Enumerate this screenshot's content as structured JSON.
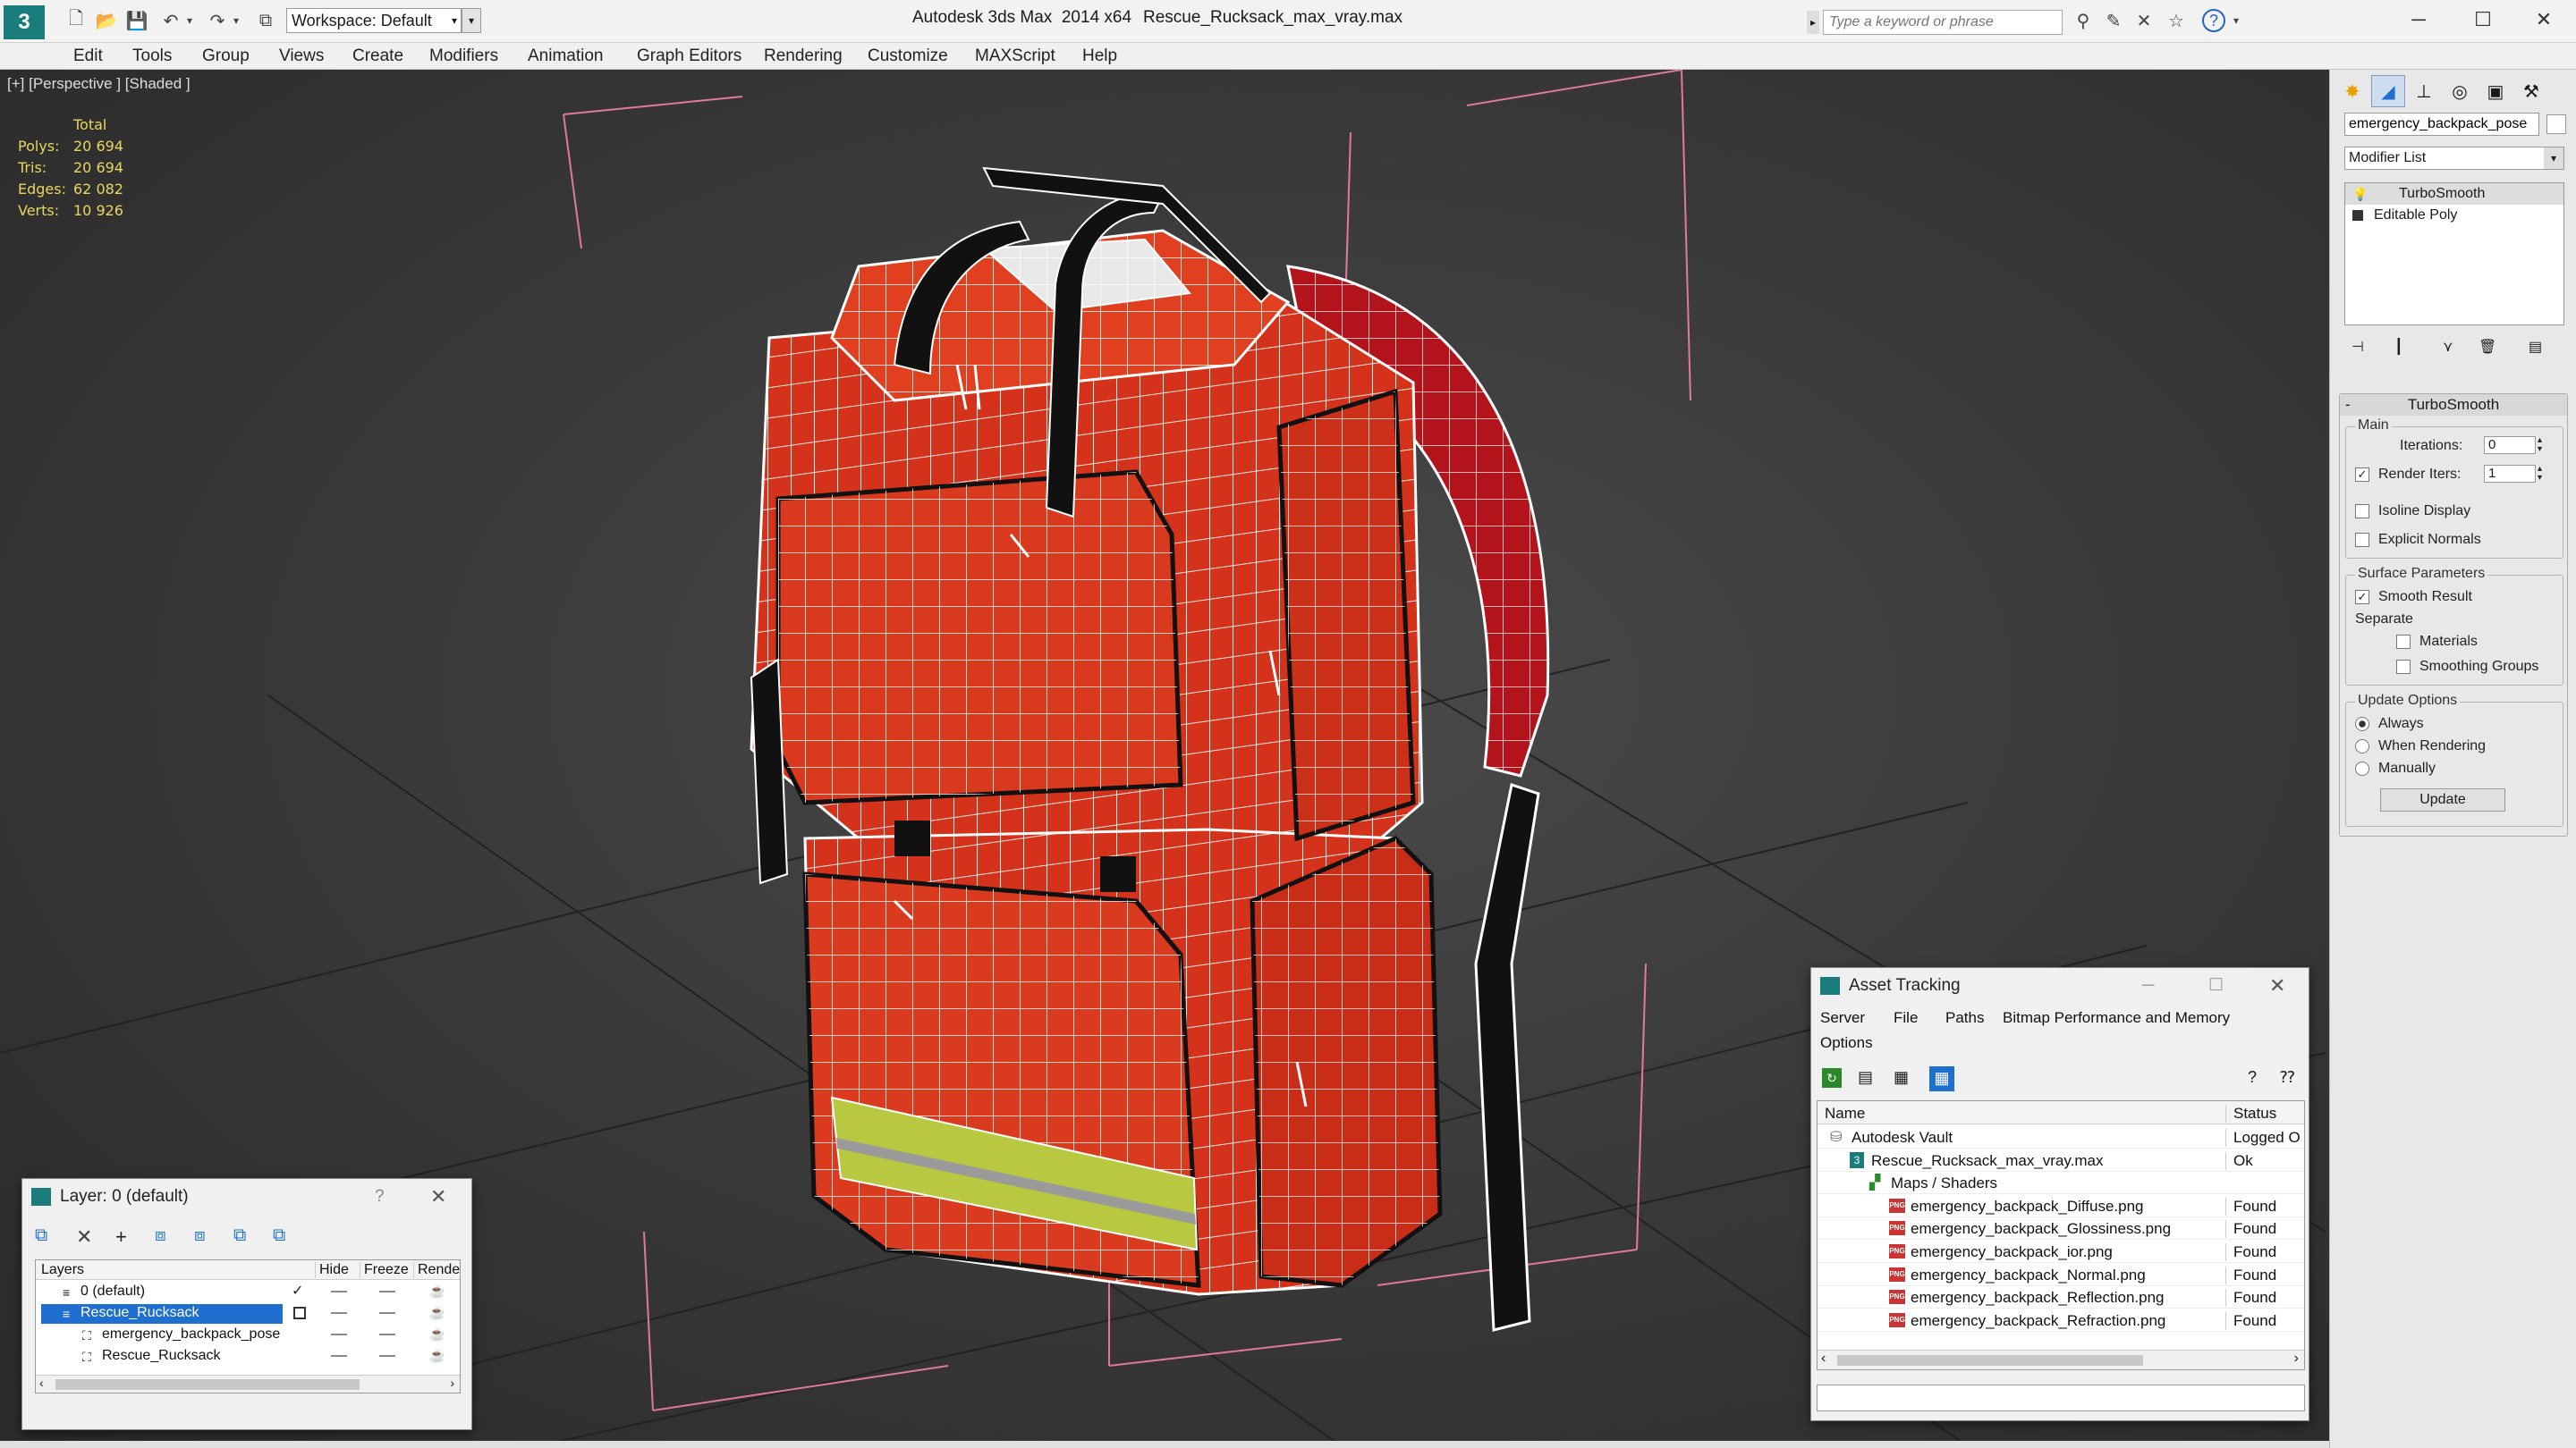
{
  "titlebar": {
    "app_title": "Autodesk 3ds Max  2014 x64",
    "file_title": "Rescue_Rucksack_max_vray.max",
    "workspace_label": "Workspace: Default",
    "search_placeholder": "Type a keyword or phrase"
  },
  "menu": [
    "Edit",
    "Tools",
    "Group",
    "Views",
    "Create",
    "Modifiers",
    "Animation",
    "Graph Editors",
    "Rendering",
    "Customize",
    "MAXScript",
    "Help"
  ],
  "viewport": {
    "label": "[+] [Perspective ] [Shaded ]",
    "stats": {
      "header": "Total",
      "rows": [
        {
          "label": "Polys:",
          "value": "20 694"
        },
        {
          "label": "Tris:",
          "value": "20 694"
        },
        {
          "label": "Edges:",
          "value": "62 082"
        },
        {
          "label": "Verts:",
          "value": "10 926"
        }
      ]
    }
  },
  "command_panel": {
    "object_name": "emergency_backpack_pose",
    "modifier_list": "Modifier List",
    "stack": [
      "TurboSmooth",
      "Editable Poly"
    ],
    "rollout_title": "TurboSmooth",
    "main_group": "Main",
    "iterations_label": "Iterations:",
    "iterations_value": "0",
    "render_iters_label": "Render Iters:",
    "render_iters_value": "1",
    "isoline_label": "Isoline Display",
    "explicit_normals_label": "Explicit Normals",
    "surface_group": "Surface Parameters",
    "smooth_result_label": "Smooth Result",
    "separate_label": "Separate",
    "materials_label": "Materials",
    "smoothing_groups_label": "Smoothing Groups",
    "update_group": "Update Options",
    "always_label": "Always",
    "when_rendering_label": "When Rendering",
    "manually_label": "Manually",
    "update_button": "Update"
  },
  "layer_dialog": {
    "title": "Layer: 0 (default)",
    "help": "?",
    "columns": [
      "Layers",
      "Hide",
      "Freeze",
      "Render"
    ],
    "rows": [
      {
        "name": "0 (default)",
        "indent": 0
      },
      {
        "name": "Rescue_Rucksack",
        "indent": 0,
        "selected": true
      },
      {
        "name": "emergency_backpack_pose",
        "indent": 1
      },
      {
        "name": "Rescue_Rucksack",
        "indent": 1
      }
    ]
  },
  "asset_dialog": {
    "title": "Asset Tracking",
    "menu": [
      "Server",
      "File",
      "Paths",
      "Bitmap Performance and Memory",
      "Options"
    ],
    "columns": [
      "Name",
      "Status"
    ],
    "rows": [
      {
        "name": "Autodesk Vault",
        "status": "Logged O",
        "indent": 0
      },
      {
        "name": "Rescue_Rucksack_max_vray.max",
        "status": "Ok",
        "indent": 1
      },
      {
        "name": "Maps / Shaders",
        "status": "",
        "indent": 2
      },
      {
        "name": "emergency_backpack_Diffuse.png",
        "status": "Found",
        "indent": 3
      },
      {
        "name": "emergency_backpack_Glossiness.png",
        "status": "Found",
        "indent": 3
      },
      {
        "name": "emergency_backpack_ior.png",
        "status": "Found",
        "indent": 3
      },
      {
        "name": "emergency_backpack_Normal.png",
        "status": "Found",
        "indent": 3
      },
      {
        "name": "emergency_backpack_Reflection.png",
        "status": "Found",
        "indent": 3
      },
      {
        "name": "emergency_backpack_Refraction.png",
        "status": "Found",
        "indent": 3
      }
    ]
  },
  "colors": {
    "accent": "#1e6fd0",
    "stats": "#e8d660",
    "bag_red": "#d4321a",
    "reflective": "#b8c840"
  }
}
